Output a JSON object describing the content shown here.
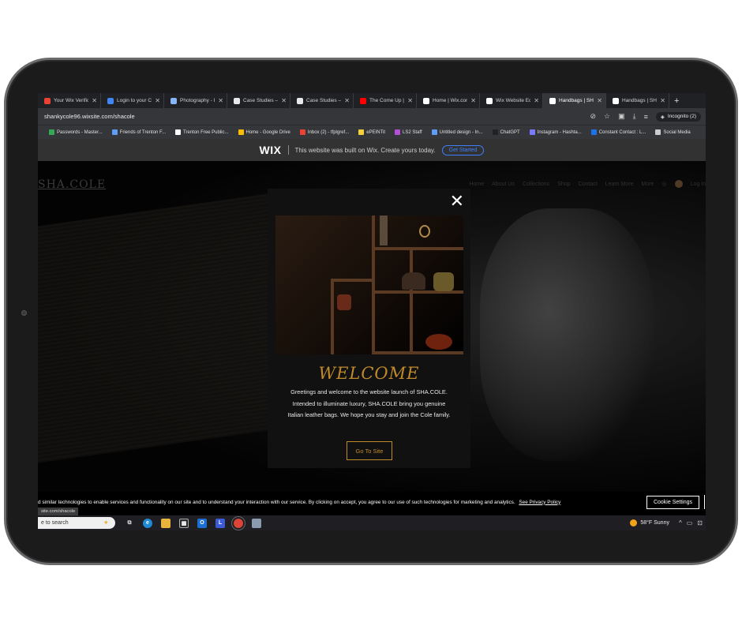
{
  "browser": {
    "tabs": [
      {
        "label": "Your Wix Verific",
        "icon": "gmail",
        "color": "#ea4335"
      },
      {
        "label": "Login to your C",
        "icon": "globe",
        "color": "#4285f4"
      },
      {
        "label": "Photography - I",
        "icon": "photo",
        "color": "#8ab4f8"
      },
      {
        "label": "Case Studies —",
        "icon": "dash",
        "color": "#e8e8e8"
      },
      {
        "label": "Case Studies —",
        "icon": "dash",
        "color": "#e8e8e8"
      },
      {
        "label": "The Come Up |",
        "icon": "youtube",
        "color": "#ff0000"
      },
      {
        "label": "Home | Wix.com",
        "icon": "wix",
        "color": "#ffffff"
      },
      {
        "label": "Wix Website Ed",
        "icon": "wix",
        "color": "#ffffff"
      },
      {
        "label": "Handbags | SHA",
        "icon": "wix",
        "color": "#ffffff",
        "active": true
      },
      {
        "label": "Handbags | SHA",
        "icon": "wix",
        "color": "#ffffff"
      }
    ],
    "new_tab": "+",
    "url": "shankycole96.wixsite.com/shacole",
    "incognito_label": "Incognito (2)",
    "bookmarks": [
      {
        "label": "Passwords - Master...",
        "color": "#34a853"
      },
      {
        "label": "Friends of Trenton F...",
        "color": "#5f9cf5"
      },
      {
        "label": "Trenton Free Public...",
        "color": "#ffffff"
      },
      {
        "label": "Home - Google Drive",
        "color": "#fbbc04"
      },
      {
        "label": "Inbox (2) - tfplgref...",
        "color": "#ea4335"
      },
      {
        "label": "ePEINTit",
        "color": "#f4d03f"
      },
      {
        "label": "LS2 Staff",
        "color": "#b44fd6"
      },
      {
        "label": "Untitled design - In...",
        "color": "#5f9cf5"
      },
      {
        "label": "ChatGPT",
        "color": "#222222"
      },
      {
        "label": "Instagram - Hashta...",
        "color": "#7a7aff"
      },
      {
        "label": "Constant Contact : L...",
        "color": "#1a73e8"
      },
      {
        "label": "Social Media",
        "color": "#cccccc"
      }
    ]
  },
  "wix_banner": {
    "logo": "WIX",
    "text": "This website was built on Wix. Create yours today.",
    "button": "Get Started"
  },
  "site": {
    "brand": "SHA.COLE",
    "nav": [
      "Home",
      "About Us",
      "Collections",
      "Shop",
      "Contact",
      "Learn More",
      "More"
    ],
    "login": "Log In"
  },
  "modal": {
    "close": "✕",
    "title": "WELCOME",
    "message": "Greetings and welcome to the website launch of SHA.COLE. Intended to illuminate luxury, SHA.COLE bring you genuine Italian leather bags. We hope you stay and join the Cole family.",
    "button": "Go To Site"
  },
  "cookie": {
    "text": "d similar technologies to enable services and functionality on our site and to understand your interaction with our service. By clicking on accept, you agree to our use of such technologies for marketing and analytics.",
    "link": "See Privacy Policy",
    "button": "Cookie Settings"
  },
  "status_url": "site.com/shacole",
  "taskbar": {
    "search": "e to search",
    "weather": "58°F  Sunny"
  },
  "colors": {
    "accent_gold": "#c08a2a",
    "wix_blue": "#3d7fff"
  }
}
